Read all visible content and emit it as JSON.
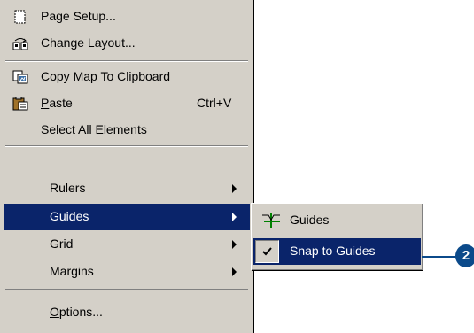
{
  "menu": {
    "items": [
      {
        "label": "Page Setup...",
        "icon": "page-setup-icon"
      },
      {
        "label": "Change Layout...",
        "icon": "change-layout-icon"
      },
      {
        "label": "Copy Map To Clipboard",
        "icon": "copy-map-icon"
      },
      {
        "label_rest": "aste",
        "label_accel": "P",
        "shortcut": "Ctrl+V",
        "icon": "paste-icon"
      },
      {
        "label": "Select All Elements"
      },
      {
        "label": "Rulers",
        "submenu": true
      },
      {
        "label": "Guides",
        "submenu": true,
        "selected": true
      },
      {
        "label": "Grid",
        "submenu": true
      },
      {
        "label": "Margins",
        "submenu": true
      },
      {
        "label_accel": "O",
        "label_rest": "ptions..."
      }
    ]
  },
  "submenu": {
    "items": [
      {
        "label": "Guides",
        "icon": "guides-icon"
      },
      {
        "label": "Snap to Guides",
        "checked": true,
        "selected": true
      }
    ]
  },
  "callout": {
    "number": "2"
  },
  "colors": {
    "menu_bg": "#d4d0c8",
    "highlight": "#0a246a",
    "callout": "#0b4a8a"
  }
}
